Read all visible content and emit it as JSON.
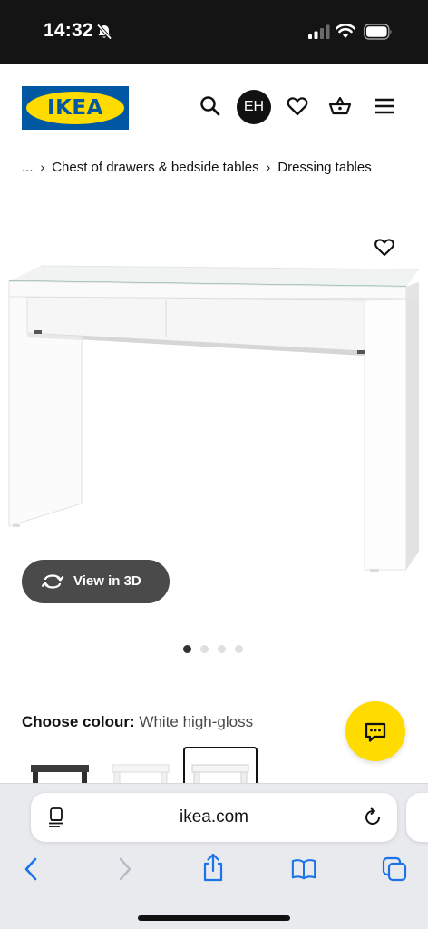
{
  "status_bar": {
    "time": "14:32"
  },
  "header": {
    "logo_text": "IKEA",
    "avatar_initials": "EH",
    "brand_colors": {
      "blue": "#0058a3",
      "yellow": "#ffdb00"
    }
  },
  "breadcrumb": {
    "ellipsis": "...",
    "items": [
      "Chest of drawers & bedside tables",
      "Dressing tables"
    ],
    "separator": "›"
  },
  "gallery": {
    "view3d_label": "View in 3D",
    "dot_count": 4,
    "active_dot": 1
  },
  "colour": {
    "label": "Choose colour:",
    "value": "White high-gloss",
    "swatches": [
      "black-brown",
      "white",
      "white high-gloss"
    ],
    "selected_index": 2
  },
  "browser": {
    "url": "ikea.com"
  },
  "icons": {
    "search": "search-icon",
    "wishlist": "heart-icon",
    "basket": "basket-icon",
    "menu": "hamburger-menu-icon",
    "chat": "chat-icon",
    "rotate": "rotate-3d-icon"
  }
}
